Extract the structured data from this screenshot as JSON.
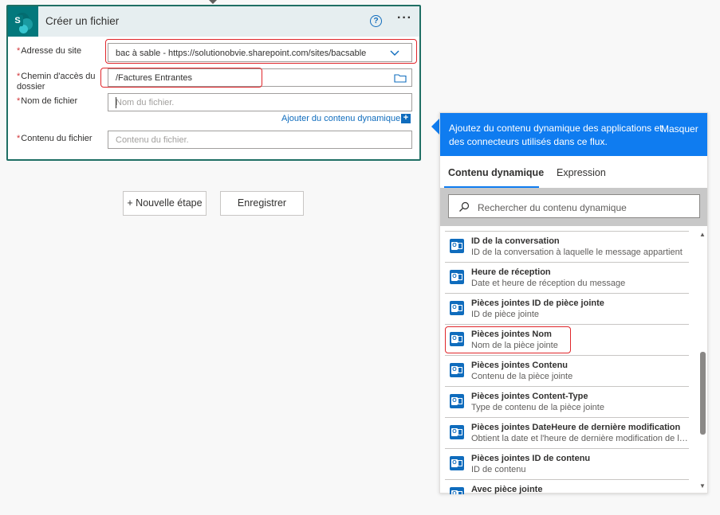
{
  "action": {
    "title": "Créer un fichier",
    "help_symbol": "?",
    "more_symbol": "···",
    "logo_letter": "S"
  },
  "fields": {
    "site": {
      "label": "Adresse du site",
      "value": "bac à sable - https://solutionobvie.sharepoint.com/sites/bacsable"
    },
    "folder": {
      "label_line1": "Chemin d'accès du",
      "label_line2": "dossier",
      "value": "/Factures Entrantes"
    },
    "filename": {
      "label": "Nom de fichier",
      "placeholder": "Nom du fichier."
    },
    "content": {
      "label": "Contenu du fichier",
      "placeholder": "Contenu du fichier."
    },
    "required_marker": "*"
  },
  "dynamic_link": {
    "label": "Ajouter du contenu dynamique",
    "plus": "+"
  },
  "buttons": {
    "new_step": "+ Nouvelle étape",
    "save": "Enregistrer"
  },
  "panel": {
    "header_text": "Ajoutez du contenu dynamique des applications et des connecteurs utilisés dans ce flux.",
    "hide_label": "Masquer",
    "tabs": [
      {
        "label": "Contenu dynamique",
        "active": true
      },
      {
        "label": "Expression",
        "active": false
      }
    ],
    "search_placeholder": "Rechercher du contenu dynamique",
    "items": [
      {
        "title": "ID de la conversation",
        "desc": "ID de la conversation à laquelle le message appartient"
      },
      {
        "title": "Heure de réception",
        "desc": "Date et heure de réception du message"
      },
      {
        "title": "Pièces jointes ID de pièce jointe",
        "desc": "ID de pièce jointe"
      },
      {
        "title": "Pièces jointes Nom",
        "desc": "Nom de la pièce jointe"
      },
      {
        "title": "Pièces jointes Contenu",
        "desc": "Contenu de la pièce jointe"
      },
      {
        "title": "Pièces jointes Content-Type",
        "desc": "Type de contenu de la pièce jointe"
      },
      {
        "title": "Pièces jointes DateHeure de dernière modification",
        "desc": "Obtient la date et l'heure de dernière modification de la p..."
      },
      {
        "title": "Pièces jointes ID de contenu",
        "desc": "ID de contenu"
      },
      {
        "title": "Avec pièce jointe",
        "desc": ""
      }
    ]
  },
  "colors": {
    "accent": "#0f7cf0",
    "card_border": "#1f6f64",
    "highlight": "#e0262b",
    "required": "#d13438"
  }
}
